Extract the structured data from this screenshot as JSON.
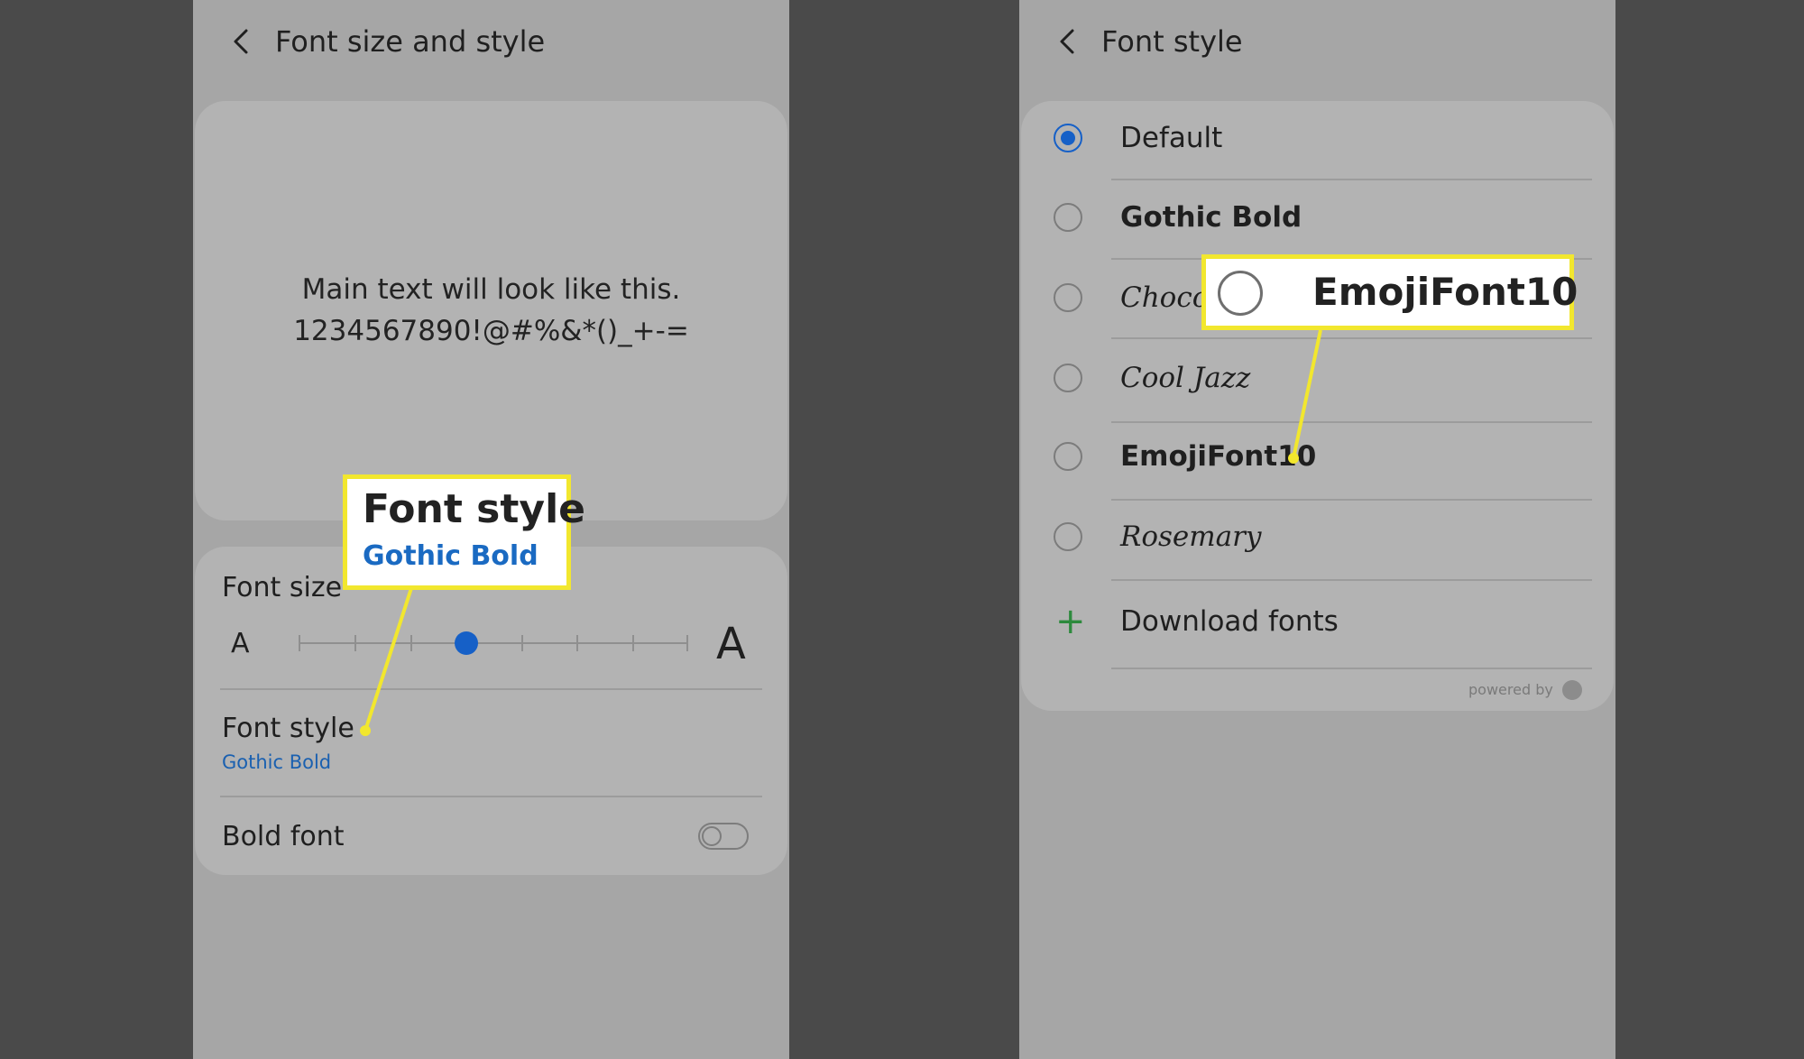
{
  "left_screen": {
    "title": "Font size and style",
    "preview_line1": "Main text will look like this.",
    "preview_line2": "1234567890!@#%&*()_+-=",
    "font_size_label": "Font size",
    "size_small_glyph": "A",
    "size_large_glyph": "A",
    "slider_level_fraction": 0.43,
    "font_style_label": "Font style",
    "font_style_value": "Gothic Bold",
    "bold_font_label": "Bold font",
    "bold_font_enabled": false,
    "callout_title": "Font style",
    "callout_value": "Gothic Bold"
  },
  "right_screen": {
    "title": "Font style",
    "options": [
      {
        "label": "Default",
        "selected": true
      },
      {
        "label": "Gothic Bold",
        "selected": false
      },
      {
        "label": "Choco",
        "selected": false
      },
      {
        "label": "Cool Jazz",
        "selected": false
      },
      {
        "label": "EmojiFont10",
        "selected": false
      },
      {
        "label": "Rosemary",
        "selected": false
      }
    ],
    "download_label": "Download fonts",
    "powered_by": "powered by",
    "callout_label": "EmojiFont10"
  },
  "colors": {
    "accent_blue": "#1660c7",
    "callout_border": "#f2e72e",
    "plus_green": "#2d8a3d"
  }
}
